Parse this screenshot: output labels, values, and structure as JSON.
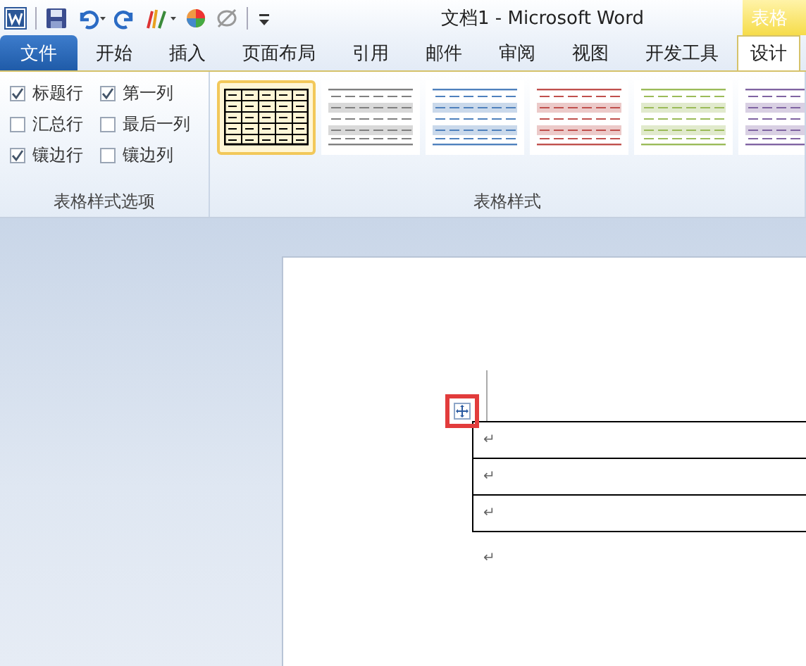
{
  "window": {
    "title": "文档1 - Microsoft Word",
    "context_tab_group": "表格"
  },
  "tabs": [
    {
      "label": "文件",
      "kind": "file",
      "selected": false
    },
    {
      "label": "开始",
      "kind": "tab",
      "selected": false
    },
    {
      "label": "插入",
      "kind": "tab",
      "selected": false
    },
    {
      "label": "页面布局",
      "kind": "tab",
      "selected": false
    },
    {
      "label": "引用",
      "kind": "tab",
      "selected": false
    },
    {
      "label": "邮件",
      "kind": "tab",
      "selected": false
    },
    {
      "label": "审阅",
      "kind": "tab",
      "selected": false
    },
    {
      "label": "视图",
      "kind": "tab",
      "selected": false
    },
    {
      "label": "开发工具",
      "kind": "tab",
      "selected": false
    },
    {
      "label": "设计",
      "kind": "context",
      "selected": true
    }
  ],
  "ribbon": {
    "style_options": {
      "label": "表格样式选项",
      "options": [
        {
          "label": "标题行",
          "checked": true
        },
        {
          "label": "汇总行",
          "checked": false
        },
        {
          "label": "镶边行",
          "checked": true
        },
        {
          "label": "第一列",
          "checked": true
        },
        {
          "label": "最后一列",
          "checked": false
        },
        {
          "label": "镶边列",
          "checked": false
        }
      ]
    },
    "table_styles": {
      "label": "表格样式",
      "styles": [
        {
          "kind": "grid",
          "color": "#000000",
          "selected": true
        },
        {
          "kind": "banded",
          "color": "#808080",
          "selected": false
        },
        {
          "kind": "banded",
          "color": "#4f81bd",
          "selected": false
        },
        {
          "kind": "banded",
          "color": "#c0504d",
          "selected": false
        },
        {
          "kind": "banded",
          "color": "#9bbb59",
          "selected": false
        },
        {
          "kind": "banded",
          "color": "#8064a2",
          "selected": false
        }
      ]
    }
  },
  "document": {
    "table_rows": [
      {
        "mark": "↵"
      },
      {
        "mark": "↵"
      },
      {
        "mark": "↵"
      }
    ],
    "trailing_mark": "↵",
    "move_handle_highlighted": true
  }
}
